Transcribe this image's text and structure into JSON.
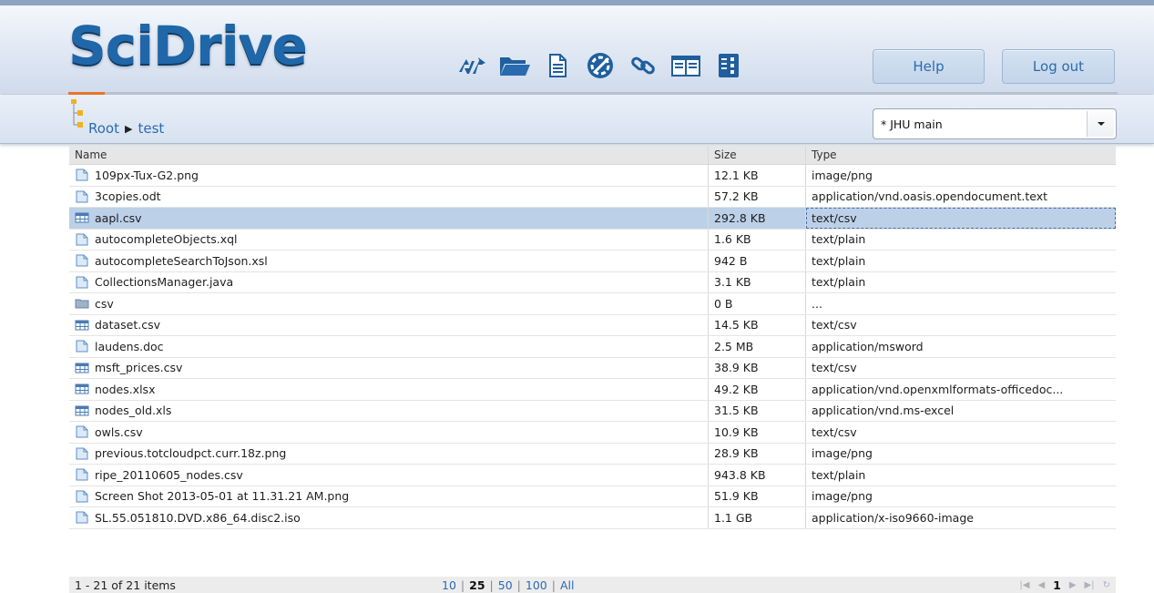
{
  "app": {
    "logo": "SciDrive"
  },
  "toolbar": {
    "icons": [
      "sync-icon",
      "folder-icon",
      "document-icon",
      "share-icon",
      "link-icon",
      "columns-icon",
      "metadata-icon"
    ]
  },
  "header": {
    "help_label": "Help",
    "logout_label": "Log out"
  },
  "upload": {
    "progress": 0.035,
    "color": "#e8742a"
  },
  "breadcrumb": {
    "root": "Root",
    "current": "test",
    "separator": "▶"
  },
  "share_select": {
    "value": "* JHU main"
  },
  "grid": {
    "columns": {
      "name": "Name",
      "size": "Size",
      "type": "Type"
    },
    "rows": [
      {
        "name": "109px-Tux-G2.png",
        "size": "12.1 KB",
        "type": "image/png",
        "icon": "file-icon"
      },
      {
        "name": "3copies.odt",
        "size": "57.2 KB",
        "type": "application/vnd.oasis.opendocument.text",
        "icon": "file-icon"
      },
      {
        "name": "aapl.csv",
        "size": "292.8 KB",
        "type": "text/csv",
        "icon": "table-icon",
        "selected": true
      },
      {
        "name": "autocompleteObjects.xql",
        "size": "1.6 KB",
        "type": "text/plain",
        "icon": "file-icon"
      },
      {
        "name": "autocompleteSearchToJson.xsl",
        "size": "942 B",
        "type": "text/plain",
        "icon": "file-icon"
      },
      {
        "name": "CollectionsManager.java",
        "size": "3.1 KB",
        "type": "text/plain",
        "icon": "file-icon"
      },
      {
        "name": "csv",
        "size": "0 B",
        "type": "...",
        "icon": "folder-icon"
      },
      {
        "name": "dataset.csv",
        "size": "14.5 KB",
        "type": "text/csv",
        "icon": "table-icon"
      },
      {
        "name": "laudens.doc",
        "size": "2.5 MB",
        "type": "application/msword",
        "icon": "file-icon"
      },
      {
        "name": "msft_prices.csv",
        "size": "38.9 KB",
        "type": "text/csv",
        "icon": "table-icon"
      },
      {
        "name": "nodes.xlsx",
        "size": "49.2 KB",
        "type": "application/vnd.openxmlformats-officedoc...",
        "icon": "table-icon"
      },
      {
        "name": "nodes_old.xls",
        "size": "31.5 KB",
        "type": "application/vnd.ms-excel",
        "icon": "table-icon"
      },
      {
        "name": "owls.csv",
        "size": "10.9 KB",
        "type": "text/csv",
        "icon": "file-icon"
      },
      {
        "name": "previous.totcloudpct.curr.18z.png",
        "size": "28.9 KB",
        "type": "image/png",
        "icon": "file-icon"
      },
      {
        "name": "ripe_20110605_nodes.csv",
        "size": "943.8 KB",
        "type": "text/plain",
        "icon": "file-icon"
      },
      {
        "name": "Screen Shot 2013-05-01 at 11.31.21 AM.png",
        "size": "51.9 KB",
        "type": "image/png",
        "icon": "file-icon"
      },
      {
        "name": "SL.55.051810.DVD.x86_64.disc2.iso",
        "size": "1.1 GB",
        "type": "application/x-iso9660-image",
        "icon": "file-icon"
      }
    ]
  },
  "pager": {
    "summary": "1 - 21 of 21 items",
    "page_sizes": [
      "10",
      "25",
      "50",
      "100",
      "All"
    ],
    "current_page_size": "25",
    "current_page": "1"
  },
  "colors": {
    "accent": "#2a6bb0",
    "selected_row": "#bcd0e8",
    "logo": "#1f67a8"
  }
}
